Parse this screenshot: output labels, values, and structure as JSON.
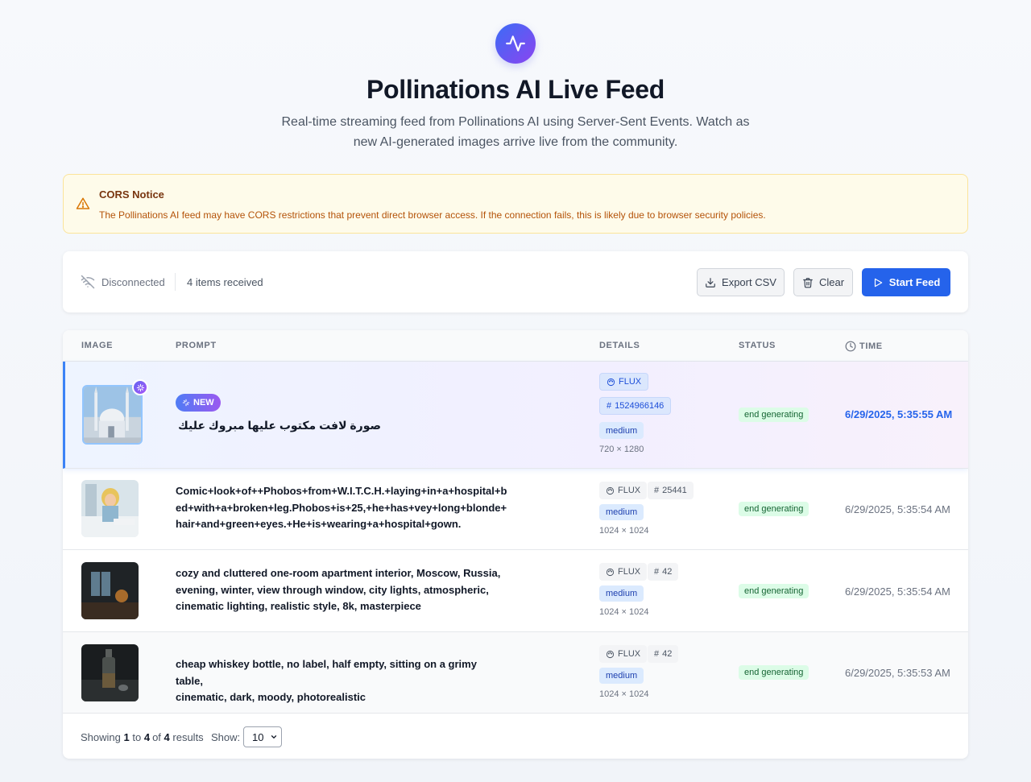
{
  "header": {
    "title": "Pollinations AI Live Feed",
    "subtitle_line1": "Real-time streaming feed from Pollinations AI using Server-Sent Events. Watch as",
    "subtitle_line2": "new AI-generated images arrive live from the community."
  },
  "notice": {
    "title": "CORS Notice",
    "text": "The Pollinations AI feed may have CORS restrictions that prevent direct browser access. If the connection fails, this is likely due to browser security policies."
  },
  "controls": {
    "connection_status": "Disconnected",
    "items_received": "4 items received",
    "export_label": "Export CSV",
    "clear_label": "Clear",
    "start_label": "Start Feed"
  },
  "table": {
    "headers": {
      "image": "IMAGE",
      "prompt": "PROMPT",
      "details": "DETAILS",
      "status": "STATUS",
      "time": "TIME"
    },
    "rows": [
      {
        "badge": "NEW",
        "prompt_lines": [
          "صورة لافت مكتوب عليها مبروك عليك"
        ],
        "model": "FLUX",
        "seed": "1524966146",
        "quality": "medium",
        "size": "720 × 1280",
        "status": "end generating",
        "time": "6/29/2025, 5:35:55 AM"
      },
      {
        "prompt_lines": [
          "Comic+look+of++Phobos+from+W.I.T.C.H.+laying+in+a+hospital+b",
          "ed+with+a+broken+leg.Phobos+is+25,+he+has+vey+long+blonde+",
          "hair+and+green+eyes.+He+is+wearing+a+hospital+gown."
        ],
        "model": "FLUX",
        "seed": "25441",
        "quality": "medium",
        "size": "1024 × 1024",
        "status": "end generating",
        "time": "6/29/2025, 5:35:54 AM"
      },
      {
        "prompt_lines": [
          "cozy and cluttered one-room apartment interior, Moscow, Russia,",
          "evening, winter, view through window, city lights, atmospheric,",
          "cinematic lighting, realistic style, 8k, masterpiece"
        ],
        "model": "FLUX",
        "seed": "42",
        "quality": "medium",
        "size": "1024 × 1024",
        "status": "end generating",
        "time": "6/29/2025, 5:35:54 AM"
      },
      {
        "prompt_lines": [
          "cheap whiskey bottle, no label, half empty, sitting on a grimy table,",
          "cinematic, dark, moody, photorealistic"
        ],
        "model": "FLUX",
        "seed": "42",
        "quality": "medium",
        "size": "1024 × 1024",
        "status": "end generating",
        "time": "6/29/2025, 5:35:53 AM"
      }
    ]
  },
  "footer": {
    "showing_prefix": "Showing",
    "from": "1",
    "to_word": "to",
    "to": "4",
    "of_word": "of",
    "total": "4",
    "results_word": "results",
    "show_label": "Show:",
    "page_size": "10"
  },
  "colors": {
    "accent": "#2563eb",
    "status_bg": "#dcfce7",
    "notice_bg": "#fefbea"
  }
}
